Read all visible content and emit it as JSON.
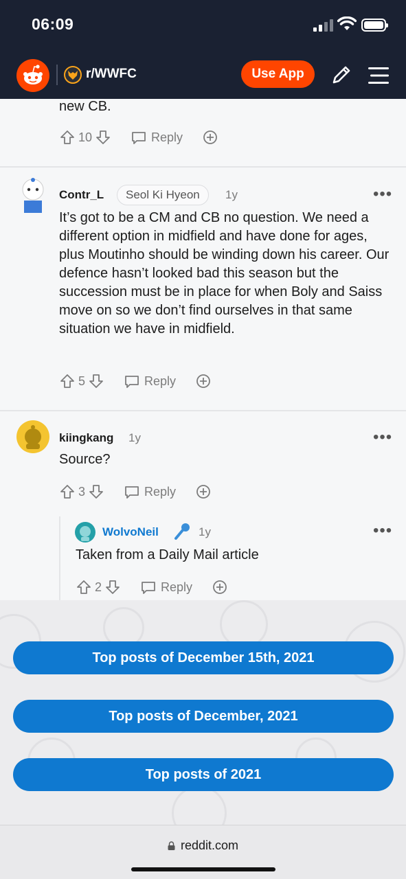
{
  "status_bar": {
    "time": "06:09"
  },
  "navbar": {
    "subreddit": "r/WWFC",
    "use_app_label": "Use App"
  },
  "comments": [
    {
      "body_tail": "new CB.",
      "votes": "10",
      "reply_label": "Reply"
    },
    {
      "username": "Contr_L",
      "flair": "Seol Ki Hyeon",
      "age": "1y",
      "body": "It’s got to be a CM and CB no question. We need a different option in midfield and have done for ages, plus Moutinho should be winding down his career. Our defence hasn’t looked bad this season but the succession must be in place for when Boly and Saiss move on so we don’t find ourselves in that same situation we have in midfield.",
      "votes": "5",
      "reply_label": "Reply"
    },
    {
      "username": "kiingkang",
      "age": "1y",
      "body": "Source?",
      "votes": "3",
      "reply_label": "Reply"
    },
    {
      "username": "WolvoNeil",
      "age": "1y",
      "body": "Taken from a Daily Mail article",
      "votes": "2",
      "reply_label": "Reply",
      "username_color": "#0f79d0"
    }
  ],
  "top_posts": {
    "day": "Top posts of December 15th, 2021",
    "month": "Top posts of December, 2021",
    "year": "Top posts of 2021"
  },
  "url_bar": {
    "domain": "reddit.com"
  },
  "colors": {
    "reddit_orange": "#ff4500",
    "header_bg": "#1a2132",
    "button_blue": "#0f79d0"
  }
}
